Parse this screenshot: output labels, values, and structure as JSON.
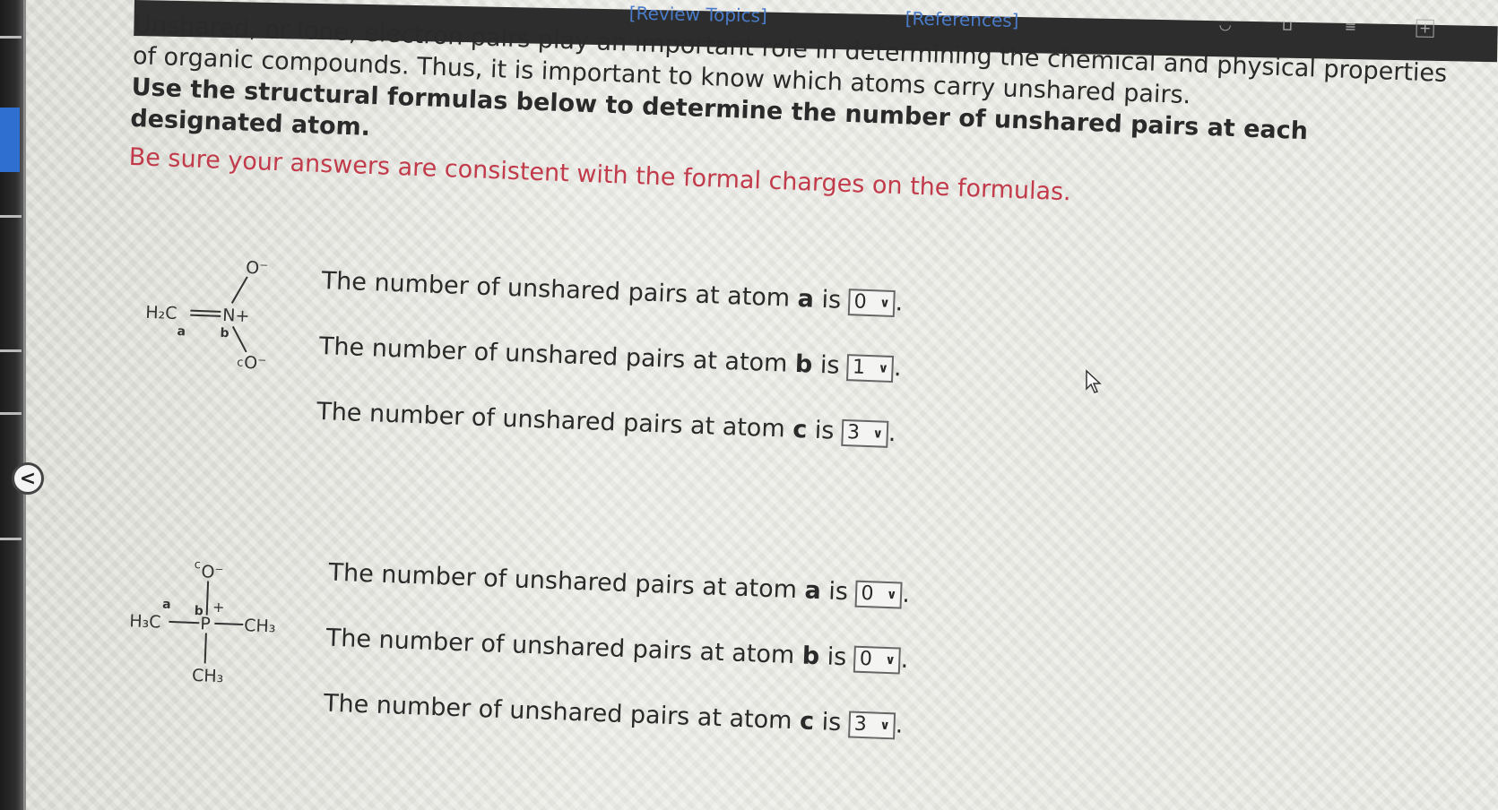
{
  "header": {
    "review_topics": "[Review Topics]",
    "references": "[References]"
  },
  "intro": "Unshared, or lone, electron pairs play an important role in determining the chemical and physical properties of organic compounds. Thus, it is important to know which atoms carry unshared pairs.",
  "instruction": "Use the structural formulas below to determine the number of unshared pairs at each designated atom.",
  "warning": "Be sure your answers are consistent with the formal charges on the formulas.",
  "question_text": "The number of unshared pairs at atom",
  "is_word": "is",
  "period": ".",
  "molecule1": {
    "h2c": "H₂C",
    "n_plus": "N+",
    "o_top": "O⁻",
    "o_bottom": "O⁻",
    "label_a": "a",
    "label_b": "b",
    "label_c": "c"
  },
  "molecule2": {
    "h3c": "H₃C",
    "p": "P",
    "plus": "+",
    "o_top": "O⁻",
    "ch3_right": "CH₃",
    "ch3_bottom": "CH₃",
    "label_a": "a",
    "label_b": "b",
    "label_c": "c"
  },
  "questions_set1": [
    {
      "atom": "a",
      "answer": "0"
    },
    {
      "atom": "b",
      "answer": "1"
    },
    {
      "atom": "c",
      "answer": "3"
    }
  ],
  "questions_set2": [
    {
      "atom": "a",
      "answer": "0"
    },
    {
      "atom": "b",
      "answer": "0"
    },
    {
      "atom": "c",
      "answer": "3"
    }
  ],
  "colors": {
    "warning": "#c23b4b",
    "link": "#4a7cc9",
    "accent_tab": "#2f6fd0"
  },
  "icons": [
    "chevron-left-icon",
    "cursor-icon",
    "chevron-down-icon"
  ]
}
